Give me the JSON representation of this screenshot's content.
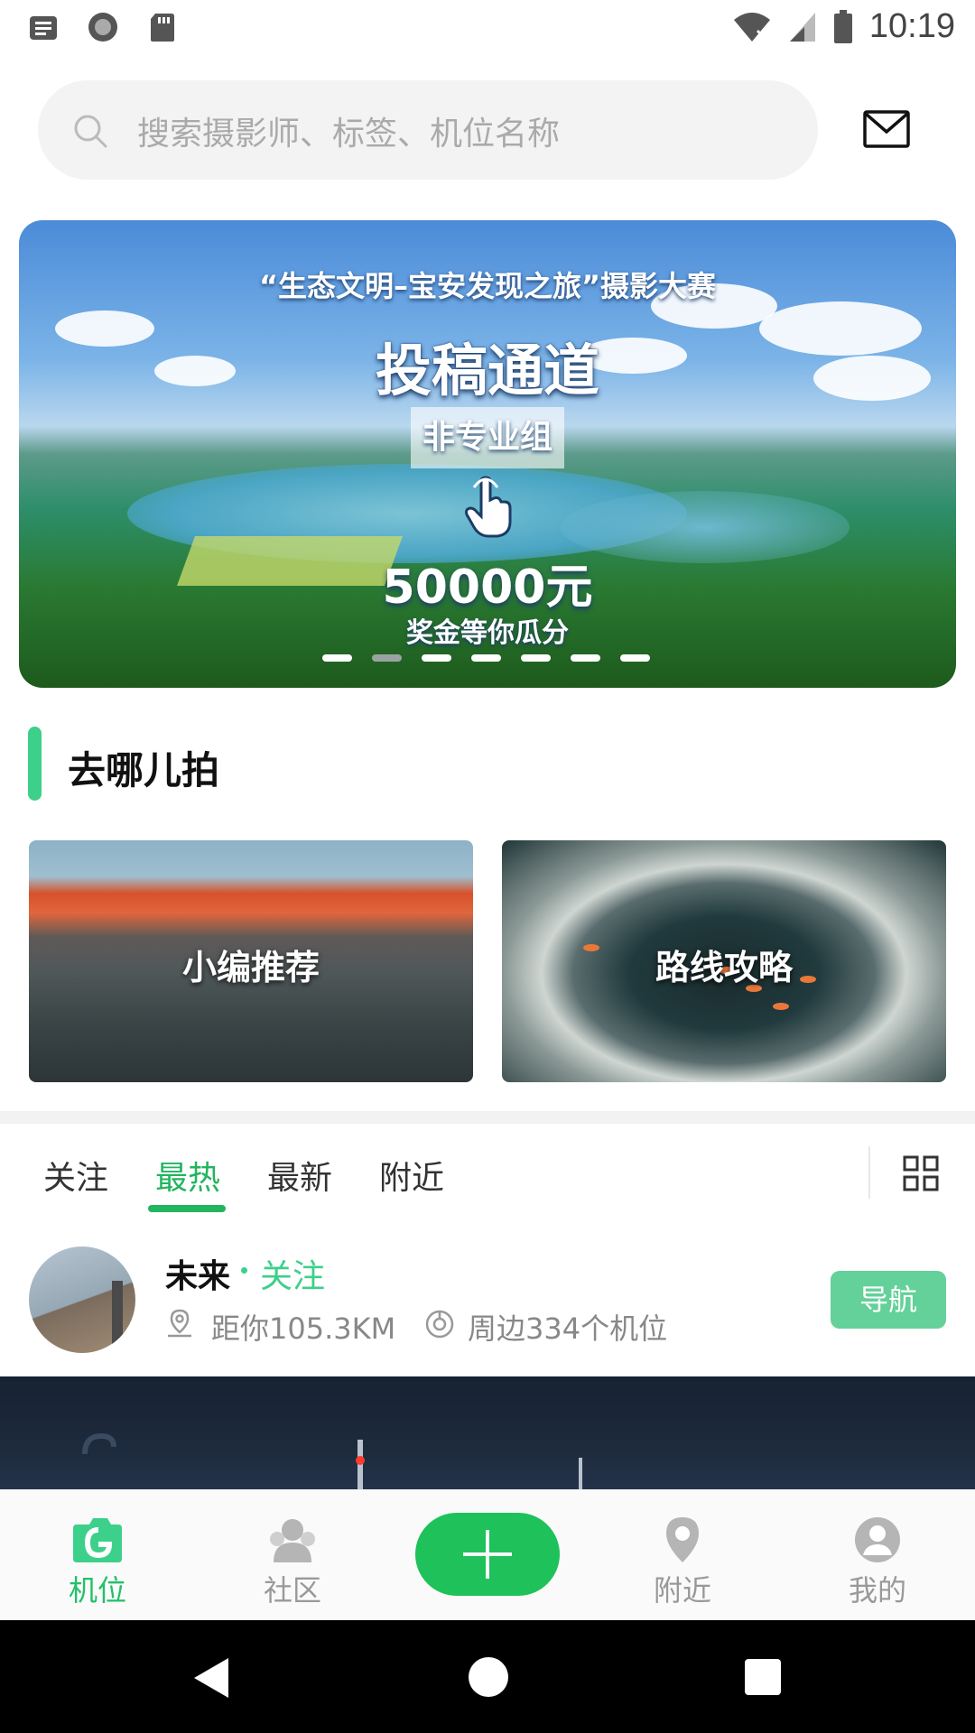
{
  "status_bar": {
    "time": "10:19",
    "left_icons": [
      "notification-icon",
      "record-icon",
      "sd-card-icon"
    ],
    "right_icons": [
      "wifi-icon",
      "signal-icon",
      "battery-icon"
    ]
  },
  "search": {
    "placeholder": "搜索摄影师、标签、机位名称"
  },
  "banner": {
    "subtitle": "“生态文明–宝安发现之旅”摄影大赛",
    "title": "投稿通道",
    "group": "非专业组",
    "prize": "50000元",
    "prize_sub": "奖金等你瓜分",
    "slide_count": 7,
    "active_slide": 2
  },
  "section": {
    "title": "去哪儿拍",
    "cards": [
      {
        "label": "小编推荐"
      },
      {
        "label": "路线攻略"
      }
    ]
  },
  "tabs": {
    "items": [
      {
        "label": "关注"
      },
      {
        "label": "最热"
      },
      {
        "label": "最新"
      },
      {
        "label": "附近"
      }
    ],
    "active": "最热"
  },
  "feed": {
    "user": {
      "name": "未来",
      "follow": "关注",
      "distance": "距你105.3KM",
      "spots": "周边334个机位",
      "nav_button": "导航"
    }
  },
  "bottom_nav": {
    "items": [
      {
        "label": "机位",
        "icon": "camera-spot-icon"
      },
      {
        "label": "社区",
        "icon": "community-icon"
      },
      {
        "label": "附近",
        "icon": "location-pin-icon"
      },
      {
        "label": "我的",
        "icon": "profile-icon"
      }
    ],
    "active": "机位"
  },
  "colors": {
    "accent": "#22b45f",
    "accent_light": "#3dd08b",
    "nav_button_bg": "#63d199",
    "plus_button": "#1ec15a"
  }
}
